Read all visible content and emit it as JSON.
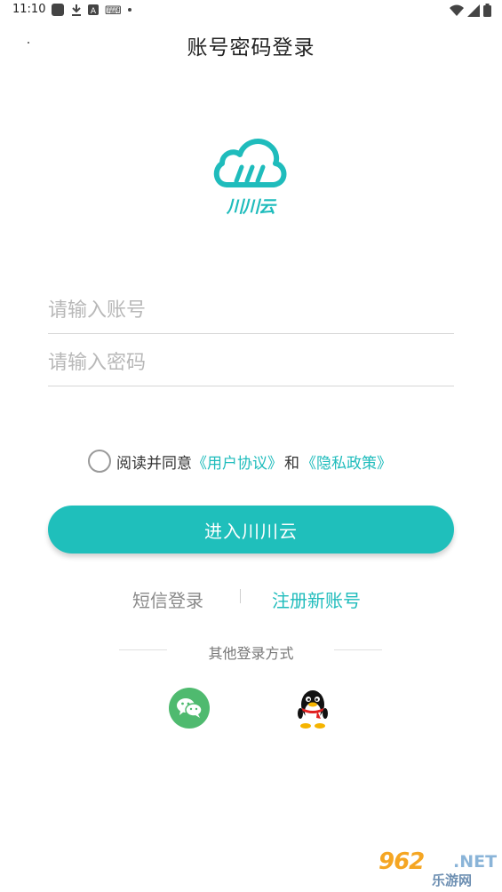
{
  "status_bar": {
    "time": "11:10",
    "icons_left": [
      "app-icon",
      "download-icon",
      "a-icon",
      "tts-icon",
      "dot-icon"
    ],
    "icons_right": [
      "wifi-icon",
      "signal-icon",
      "battery-icon"
    ]
  },
  "header": {
    "title": "账号密码登录"
  },
  "logo": {
    "text": "川川云",
    "color": "#1fbcbc"
  },
  "form": {
    "account_placeholder": "请输入账号",
    "account_value": "",
    "password_placeholder": "请输入密码",
    "password_value": ""
  },
  "agreement": {
    "checked": false,
    "prefix": "阅读并同意",
    "user_agreement": "《用户协议》",
    "and": "和",
    "privacy_policy": "《隐私政策》"
  },
  "actions": {
    "enter_label": "进入川川云",
    "sms_login": "短信登录",
    "register": "注册新账号"
  },
  "other_login": {
    "title": "其他登录方式",
    "options": [
      "wechat-icon",
      "qq-icon"
    ]
  },
  "watermark": {
    "main": "962",
    "net": ".NET",
    "sub": "乐游网"
  },
  "colors": {
    "accent": "#1fbfbb",
    "wechat": "#4fba6f"
  }
}
